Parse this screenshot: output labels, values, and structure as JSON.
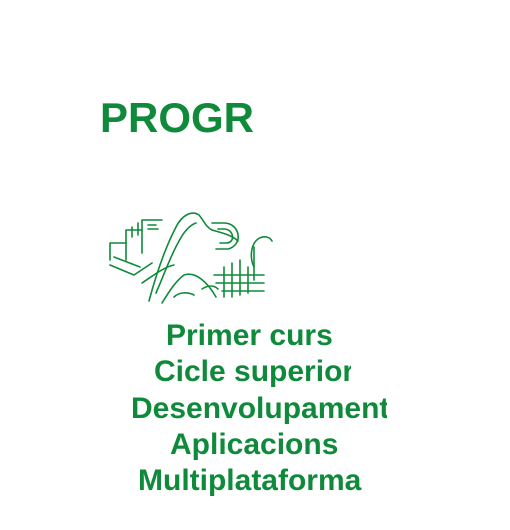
{
  "colors": {
    "accent": "#0f8a3a",
    "background": "#ffffff"
  },
  "title": "PROGRA",
  "logo": {
    "icon": "institution-seal-icon"
  },
  "lines": [
    "Primer curs",
    "Cicle superior",
    "Desenvolupament",
    "Aplicacions",
    "Multiplataforma"
  ]
}
